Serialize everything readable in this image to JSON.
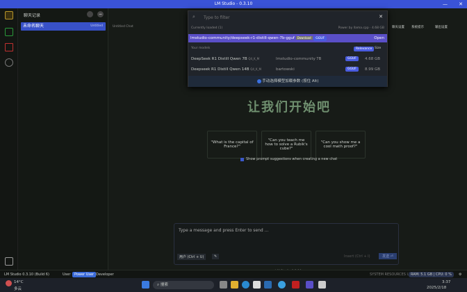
{
  "window": {
    "title": "LM Studio - 0.3.10"
  },
  "sidebar": {
    "title": "聊天记录",
    "chats": [
      {
        "name": "未命名聊天",
        "time": "Untitled"
      }
    ]
  },
  "main": {
    "chat_title": "Untitled Chat",
    "top_actions": [
      "聊天设置",
      "系统提示",
      "输出设置"
    ],
    "heading": "让我们开始吧",
    "suggestions": [
      "\"What is the capital of France?\"",
      "\"Can you teach me how to solve a Rubik's cube?\"",
      "\"Can you show me a cool math proof?\""
    ],
    "show_suggestions_label": "Show prompt suggestions when creating a new chat",
    "input_placeholder": "Type a message and press Enter to send ...",
    "user_button": "用户 (Ctrl + U)",
    "insert_button": "Insert (Ctrl + I)",
    "send_button": "发送 ⏎",
    "footer": "LM Studio 0.3.10"
  },
  "model_picker": {
    "search_placeholder": "Type to filter",
    "loaded_label": "Currently loaded (1)",
    "loaded_info": "Power by llama.cpp · 4.68 GB",
    "highlight": {
      "name": "lmstudio-community/deepseek-r1-distill-qwen-7b-gguf",
      "tag": "Download",
      "format": "GGUF",
      "action": "Open"
    },
    "your_models": "Your models",
    "sort": [
      "Relevance",
      "Size"
    ],
    "models": [
      {
        "name": "DeepSeek R1 Distill Qwen 7B",
        "quant": "Q4_K_M",
        "publisher": "lmstudio-community",
        "params": "7B",
        "format": "GGUF",
        "size": "4.68 GB"
      },
      {
        "name": "Deepseek R1 Distill Qwen 14B",
        "quant": "Q4_K_M",
        "publisher": "bartowski",
        "params": "",
        "format": "GGUF",
        "size": "8.99 GB"
      }
    ],
    "manual_label": "手动选择模型加载参数 (按住 Alt)"
  },
  "status": {
    "app": "LM Studio 0.3.10 (Build 6)",
    "modes": [
      "User",
      "Power User",
      "Developer"
    ],
    "resources_label": "SYSTEM RESOURCES USAGE",
    "resources": "RAM: 5.1 GB | CPU: 0 %"
  },
  "taskbar": {
    "weather": "14°C",
    "weather_desc": "多云",
    "search": "搜索",
    "time": "3:37",
    "date": "2025/2/18"
  },
  "colors": {
    "accent": "#4a5ce0",
    "titlebar": "#3a53d6",
    "highlight": "#5a4fc8"
  }
}
